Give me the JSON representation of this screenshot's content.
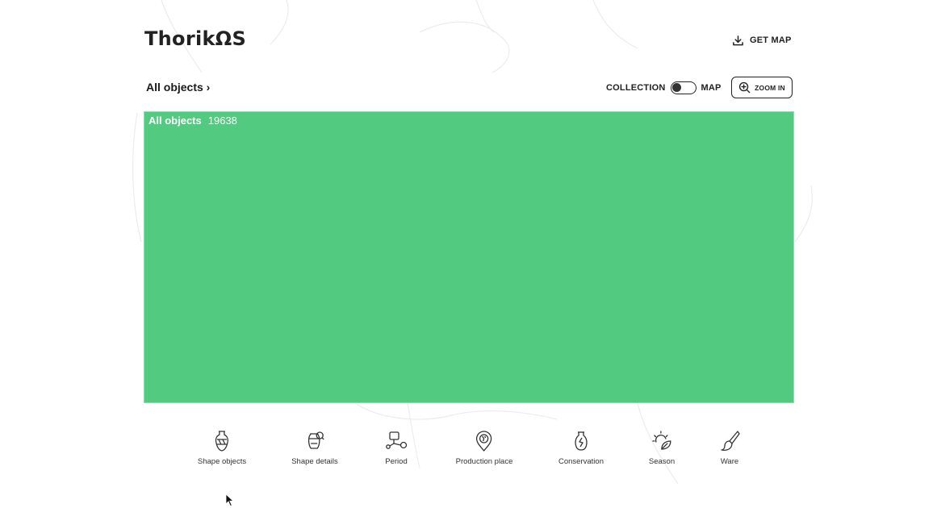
{
  "app": {
    "title": "ThorikΩS"
  },
  "header": {
    "get_map_label": "GET MAP",
    "get_map_icon": "download-icon"
  },
  "breadcrumb": {
    "label": "All objects ›"
  },
  "view_toggle": {
    "left_label": "COLLECTION",
    "right_label": "MAP",
    "state": "collection"
  },
  "zoom": {
    "label": "ZOOM IN",
    "icon": "zoom-in-icon"
  },
  "treemap": {
    "title": "All objects",
    "count": "19638",
    "color": "#52ca80"
  },
  "facets": [
    {
      "label": "Shape objects",
      "icon": "amphora-icon"
    },
    {
      "label": "Shape details",
      "icon": "vase-detail-icon"
    },
    {
      "label": "Period",
      "icon": "timeline-icon"
    },
    {
      "label": "Production place",
      "icon": "map-pin-icon"
    },
    {
      "label": "Conservation",
      "icon": "broken-vase-icon"
    },
    {
      "label": "Season",
      "icon": "sun-leaf-icon"
    },
    {
      "label": "Ware",
      "icon": "brush-icon"
    }
  ],
  "colors": {
    "accent": "#52ca80",
    "text": "#1a1a1a",
    "background": "#ffffff"
  }
}
